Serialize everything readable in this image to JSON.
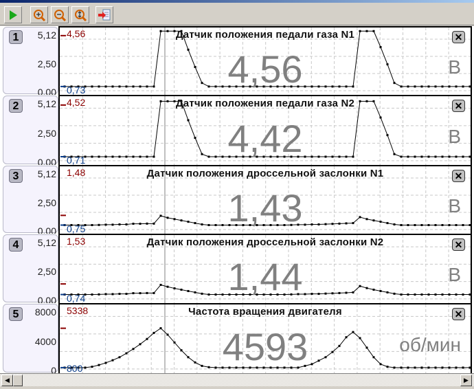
{
  "toolbar": {
    "buttons": [
      {
        "name": "play-button",
        "icon": "play-icon"
      },
      {
        "name": "zoom-in-button",
        "icon": "zoom-in-icon"
      },
      {
        "name": "zoom-out-button",
        "icon": "zoom-out-icon"
      },
      {
        "name": "zoom-fit-button",
        "icon": "zoom-vertical-icon"
      },
      {
        "name": "export-button",
        "icon": "export-icon"
      }
    ]
  },
  "close_label": "✕",
  "cursor_index": 14.6,
  "panels": [
    {
      "number": "1",
      "title": "Датчик положения педали газа N1",
      "current": "4,56",
      "unit": "В",
      "max": "4,56",
      "min": "0,73",
      "max_val": 4.56,
      "min_val": 0.73,
      "ticks": [
        "5,12",
        "2,50",
        "0,00"
      ],
      "range": [
        0,
        5.12
      ],
      "values": [
        0.73,
        0.73,
        0.73,
        0.73,
        0.73,
        0.73,
        0.73,
        0.73,
        0.73,
        0.73,
        0.73,
        0.73,
        0.73,
        0.73,
        4.9,
        4.9,
        4.9,
        4.9,
        3.5,
        2.2,
        1.0,
        0.73,
        0.73,
        0.73,
        0.73,
        0.73,
        0.73,
        0.73,
        0.73,
        0.73,
        0.73,
        0.73,
        0.73,
        0.73,
        0.73,
        0.73,
        0.73,
        0.73,
        0.73,
        0.73,
        0.73,
        0.73,
        0.73,
        4.9,
        4.9,
        4.9,
        3.7,
        2.4,
        1.0,
        0.73,
        0.73,
        0.73,
        0.73,
        0.73,
        0.73,
        0.73,
        0.73,
        0.73,
        0.73,
        0.73
      ]
    },
    {
      "number": "2",
      "title": "Датчик положения педали газа N2",
      "current": "4,42",
      "unit": "В",
      "max": "4,52",
      "min": "0,71",
      "max_val": 4.52,
      "min_val": 0.71,
      "ticks": [
        "5,12",
        "2,50",
        "0,00"
      ],
      "range": [
        0,
        5.12
      ],
      "values": [
        0.71,
        0.71,
        0.71,
        0.71,
        0.71,
        0.71,
        0.71,
        0.71,
        0.71,
        0.71,
        0.71,
        0.71,
        0.71,
        0.71,
        4.8,
        4.8,
        4.8,
        4.8,
        3.4,
        2.1,
        0.9,
        0.71,
        0.71,
        0.71,
        0.71,
        0.71,
        0.71,
        0.71,
        0.71,
        0.71,
        0.71,
        0.71,
        0.71,
        0.71,
        0.71,
        0.71,
        0.71,
        0.71,
        0.71,
        0.71,
        0.71,
        0.71,
        0.71,
        4.8,
        4.8,
        4.8,
        3.6,
        2.3,
        0.9,
        0.71,
        0.71,
        0.71,
        0.71,
        0.71,
        0.71,
        0.71,
        0.71,
        0.71,
        0.71,
        0.71
      ]
    },
    {
      "number": "3",
      "title": "Датчик положения дроссельной заслонки N1",
      "current": "1,43",
      "unit": "В",
      "max": "1,48",
      "min": "0,75",
      "max_val": 1.48,
      "min_val": 0.75,
      "ticks": [
        "5,12",
        "2,50",
        "0,00"
      ],
      "range": [
        0,
        5.12
      ],
      "values": [
        0.75,
        0.75,
        0.75,
        0.75,
        0.75,
        0.76,
        0.78,
        0.78,
        0.8,
        0.8,
        0.85,
        0.85,
        0.86,
        0.86,
        1.45,
        1.3,
        1.2,
        1.1,
        1.0,
        0.9,
        0.8,
        0.75,
        0.75,
        0.75,
        0.75,
        0.75,
        0.75,
        0.75,
        0.75,
        0.75,
        0.75,
        0.75,
        0.75,
        0.76,
        0.78,
        0.78,
        0.8,
        0.8,
        0.82,
        0.84,
        0.86,
        0.88,
        0.9,
        1.35,
        1.2,
        1.1,
        1.0,
        0.9,
        0.8,
        0.75,
        0.75,
        0.75,
        0.75,
        0.75,
        0.75,
        0.75,
        0.75,
        0.75,
        0.75,
        0.75
      ]
    },
    {
      "number": "4",
      "title": "Датчик положения дроссельной заслонки N2",
      "current": "1,44",
      "unit": "В",
      "max": "1,53",
      "min": "0,74",
      "max_val": 1.53,
      "min_val": 0.74,
      "ticks": [
        "5,12",
        "2,50",
        "0,00"
      ],
      "range": [
        0,
        5.12
      ],
      "values": [
        0.74,
        0.74,
        0.74,
        0.74,
        0.74,
        0.75,
        0.77,
        0.77,
        0.79,
        0.79,
        0.84,
        0.84,
        0.85,
        0.85,
        1.46,
        1.32,
        1.2,
        1.1,
        1.0,
        0.9,
        0.8,
        0.74,
        0.74,
        0.74,
        0.74,
        0.74,
        0.74,
        0.74,
        0.74,
        0.74,
        0.74,
        0.74,
        0.74,
        0.75,
        0.77,
        0.77,
        0.79,
        0.79,
        0.81,
        0.83,
        0.85,
        0.87,
        0.9,
        1.37,
        1.22,
        1.1,
        1.0,
        0.9,
        0.8,
        0.74,
        0.74,
        0.74,
        0.74,
        0.74,
        0.74,
        0.74,
        0.74,
        0.74,
        0.74,
        0.74
      ]
    },
    {
      "number": "5",
      "title": "Частота вращения двигателя",
      "current": "4593",
      "unit": "об/мин",
      "max": "5338",
      "min": "800",
      "max_val": 5338,
      "min_val": 800,
      "ticks": [
        "8000",
        "4000",
        "0"
      ],
      "range": [
        0,
        8000
      ],
      "values": [
        800,
        800,
        800,
        800,
        900,
        1100,
        1350,
        1650,
        2000,
        2450,
        2950,
        3500,
        4100,
        4800,
        5338,
        4600,
        3700,
        2800,
        2000,
        1400,
        1000,
        850,
        800,
        800,
        800,
        800,
        800,
        800,
        800,
        800,
        800,
        800,
        800,
        800,
        800,
        1000,
        1200,
        1600,
        2000,
        2600,
        3300,
        4300,
        4900,
        4200,
        3100,
        2000,
        1200,
        900,
        800,
        800,
        800,
        800,
        800,
        800,
        800,
        800,
        800,
        800,
        800,
        800
      ]
    }
  ],
  "scroll": {
    "left": "◀",
    "right": "▶"
  }
}
